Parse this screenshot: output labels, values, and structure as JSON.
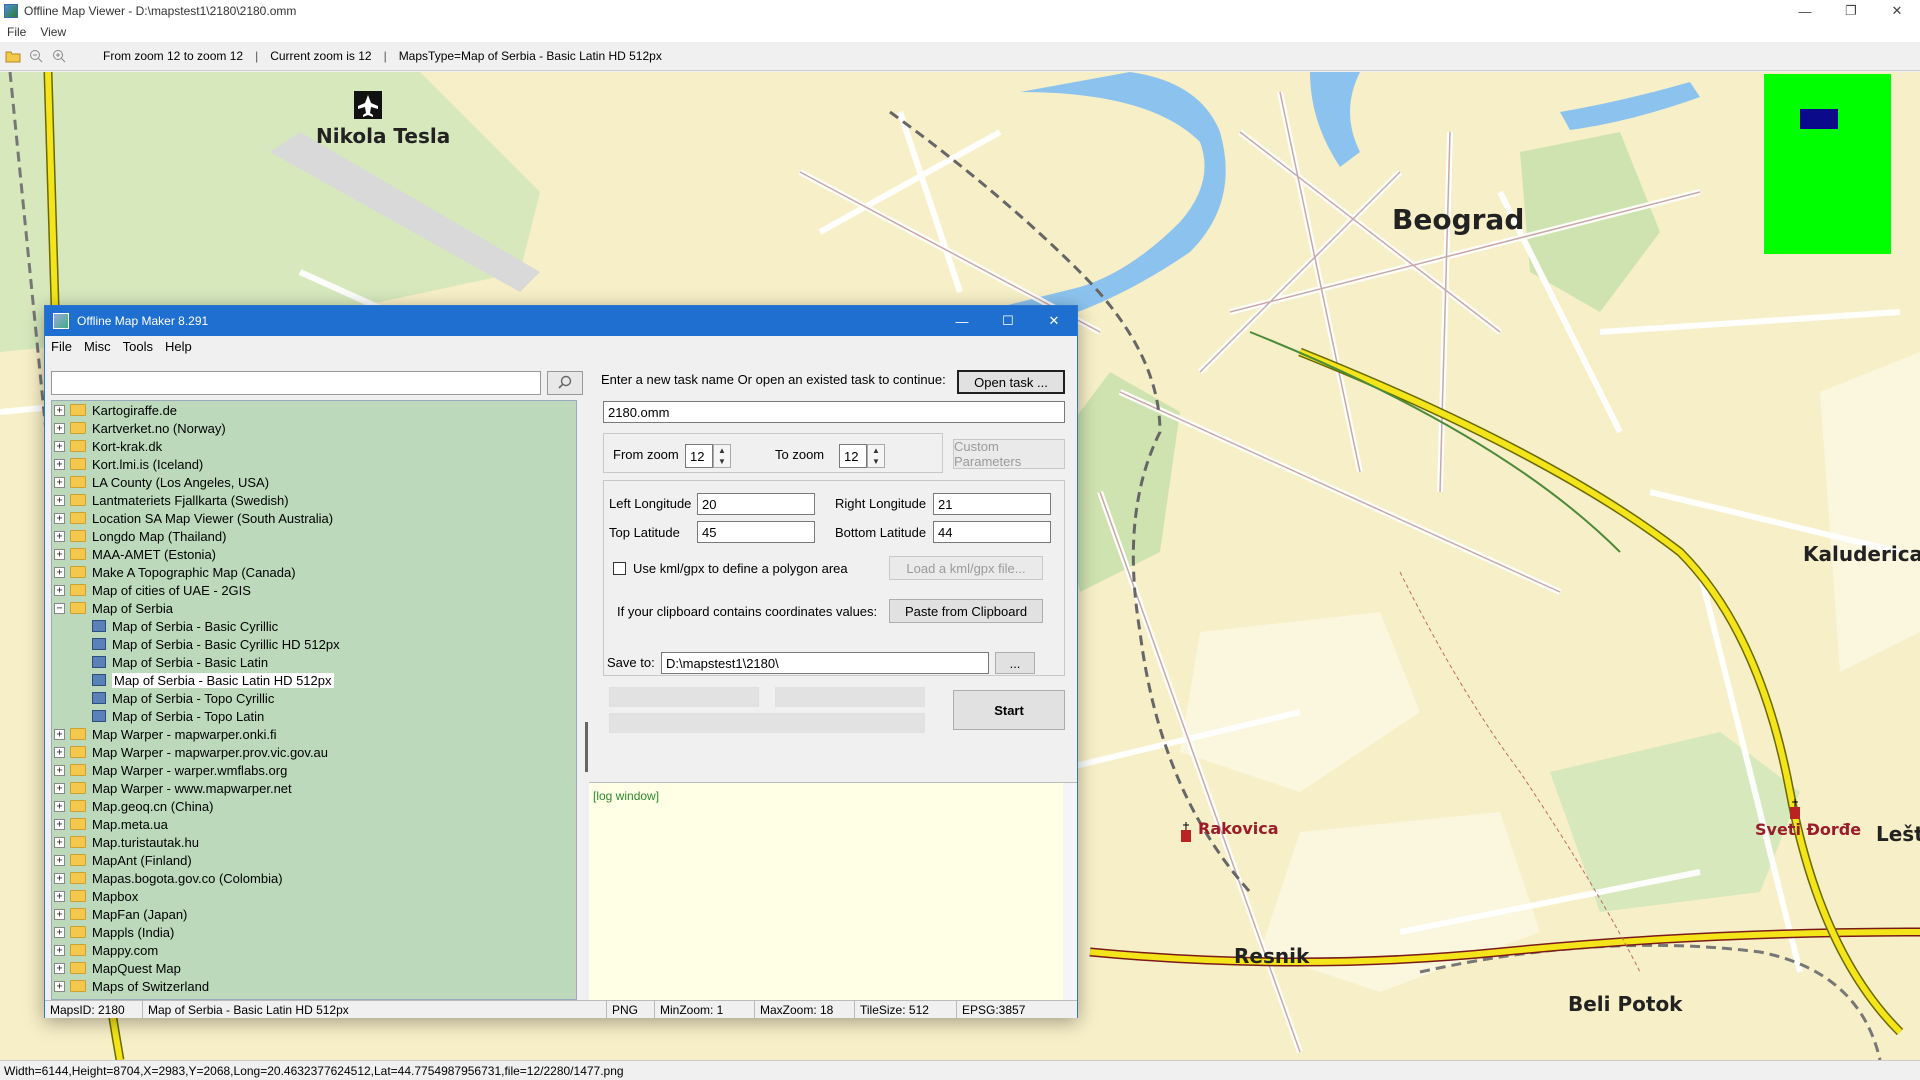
{
  "window": {
    "title": "Offline Map Viewer - D:\\mapstest1\\2180\\2180.omm",
    "menu": [
      "File",
      "View"
    ],
    "controls": [
      "—",
      "❐",
      "✕"
    ]
  },
  "toolbar": {
    "zoom_range": "From zoom 12 to zoom 12",
    "separator": "|",
    "current_zoom": "Current zoom is 12",
    "maps_type": "MapsType=Map of Serbia - Basic Latin HD 512px"
  },
  "map": {
    "labels": {
      "airport": "Nikola Tesla",
      "city": "Beograd",
      "kaluderica": "Kaluderica",
      "rakovica": "Rakovica",
      "sveti_dorde": "Sveti Đorđe",
      "lesta": "Lešta",
      "resnik": "Resnik",
      "beli_potok": "Beli Potok"
    },
    "colors": {
      "land": "#f7efc7",
      "water": "#8cc3ee",
      "forest": "#cfe3b0",
      "road": "#ffffff",
      "highway": "#f4e41a",
      "overview_bg": "#00ff00",
      "overview_viewport": "#0a0a8a"
    }
  },
  "status_bar": {
    "text": "Width=6144,Height=8704,X=2983,Y=2068,Long=20.4632377624512,Lat=44.7754987956731,file=12/2280/1477.png"
  },
  "dialog": {
    "title": "Offline Map Maker 8.291",
    "controls": [
      "—",
      "☐",
      "✕"
    ],
    "menu": [
      "File",
      "Misc",
      "Tools",
      "Help"
    ],
    "search": {
      "value": "",
      "placeholder": "",
      "icon": "search-icon"
    },
    "tree": [
      {
        "label": "Kartogiraffe.de",
        "type": "folder",
        "expanded": false
      },
      {
        "label": "Kartverket.no (Norway)",
        "type": "folder",
        "expanded": false
      },
      {
        "label": "Kort-krak.dk",
        "type": "folder",
        "expanded": false
      },
      {
        "label": "Kort.lmi.is (Iceland)",
        "type": "folder",
        "expanded": false
      },
      {
        "label": "LA County (Los Angeles, USA)",
        "type": "folder",
        "expanded": false
      },
      {
        "label": "Lantmateriets Fjallkarta (Swedish)",
        "type": "folder",
        "expanded": false
      },
      {
        "label": "Location SA Map Viewer (South Australia)",
        "type": "folder",
        "expanded": false
      },
      {
        "label": "Longdo Map (Thailand)",
        "type": "folder",
        "expanded": false
      },
      {
        "label": "MAA-AMET (Estonia)",
        "type": "folder",
        "expanded": false
      },
      {
        "label": "Make A Topographic Map (Canada)",
        "type": "folder",
        "expanded": false
      },
      {
        "label": "Map of cities of UAE - 2GIS",
        "type": "folder",
        "expanded": false
      },
      {
        "label": "Map of Serbia",
        "type": "folder",
        "expanded": true
      },
      {
        "label": "Map of Serbia - Basic Cyrillic",
        "type": "map",
        "child": true
      },
      {
        "label": "Map of Serbia - Basic Cyrillic HD 512px",
        "type": "map",
        "child": true
      },
      {
        "label": "Map of Serbia - Basic Latin",
        "type": "map",
        "child": true
      },
      {
        "label": "Map of Serbia - Basic Latin HD 512px",
        "type": "map",
        "child": true,
        "selected": true
      },
      {
        "label": "Map of Serbia - Topo Cyrillic",
        "type": "map",
        "child": true
      },
      {
        "label": "Map of Serbia - Topo Latin",
        "type": "map",
        "child": true
      },
      {
        "label": "Map Warper - mapwarper.onki.fi",
        "type": "folder",
        "expanded": false
      },
      {
        "label": "Map Warper - mapwarper.prov.vic.gov.au",
        "type": "folder",
        "expanded": false
      },
      {
        "label": "Map Warper - warper.wmflabs.org",
        "type": "folder",
        "expanded": false
      },
      {
        "label": "Map Warper - www.mapwarper.net",
        "type": "folder",
        "expanded": false
      },
      {
        "label": "Map.geoq.cn (China)",
        "type": "folder",
        "expanded": false
      },
      {
        "label": "Map.meta.ua",
        "type": "folder",
        "expanded": false
      },
      {
        "label": "Map.turistautak.hu",
        "type": "folder",
        "expanded": false
      },
      {
        "label": "MapAnt (Finland)",
        "type": "folder",
        "expanded": false
      },
      {
        "label": "Mapas.bogota.gov.co (Colombia)",
        "type": "folder",
        "expanded": false
      },
      {
        "label": "Mapbox",
        "type": "folder",
        "expanded": false
      },
      {
        "label": "MapFan (Japan)",
        "type": "folder",
        "expanded": false
      },
      {
        "label": "Mappls (India)",
        "type": "folder",
        "expanded": false
      },
      {
        "label": "Mappy.com",
        "type": "folder",
        "expanded": false
      },
      {
        "label": "MapQuest Map",
        "type": "folder",
        "expanded": false
      },
      {
        "label": "Maps of Switzerland",
        "type": "folder",
        "expanded": false
      }
    ],
    "task": {
      "prompt": "Enter a new task name Or open an existed task to continue:",
      "open_button": "Open task ...",
      "name_value": "2180.omm"
    },
    "zoom": {
      "from_label": "From zoom",
      "from_value": "12",
      "to_label": "To zoom",
      "to_value": "12",
      "custom_button": "Custom Parameters"
    },
    "bounds": {
      "left_lon_label": "Left Longitude",
      "left_lon_value": "20",
      "right_lon_label": "Right Longitude",
      "right_lon_value": "21",
      "top_lat_label": "Top Latitude",
      "top_lat_value": "45",
      "bottom_lat_label": "Bottom Latitude",
      "bottom_lat_value": "44",
      "kml_label": "Use kml/gpx to define a polygon area",
      "kml_checked": false,
      "kml_button": "Load a kml/gpx file...",
      "clipboard_label": "If your clipboard contains coordinates values:",
      "clipboard_button": "Paste from Clipboard"
    },
    "save": {
      "label": "Save to:",
      "value": "D:\\mapstest1\\2180\\",
      "browse_button": "...",
      "start_button": "Start"
    },
    "log": {
      "text": "[log window]"
    },
    "status": {
      "maps_id": "MapsID: 2180",
      "map_name": "Map of Serbia - Basic Latin HD 512px",
      "format": "PNG",
      "min_zoom": "MinZoom: 1",
      "max_zoom": "MaxZoom: 18",
      "tile_size": "TileSize: 512",
      "epsg": "EPSG:3857"
    }
  }
}
